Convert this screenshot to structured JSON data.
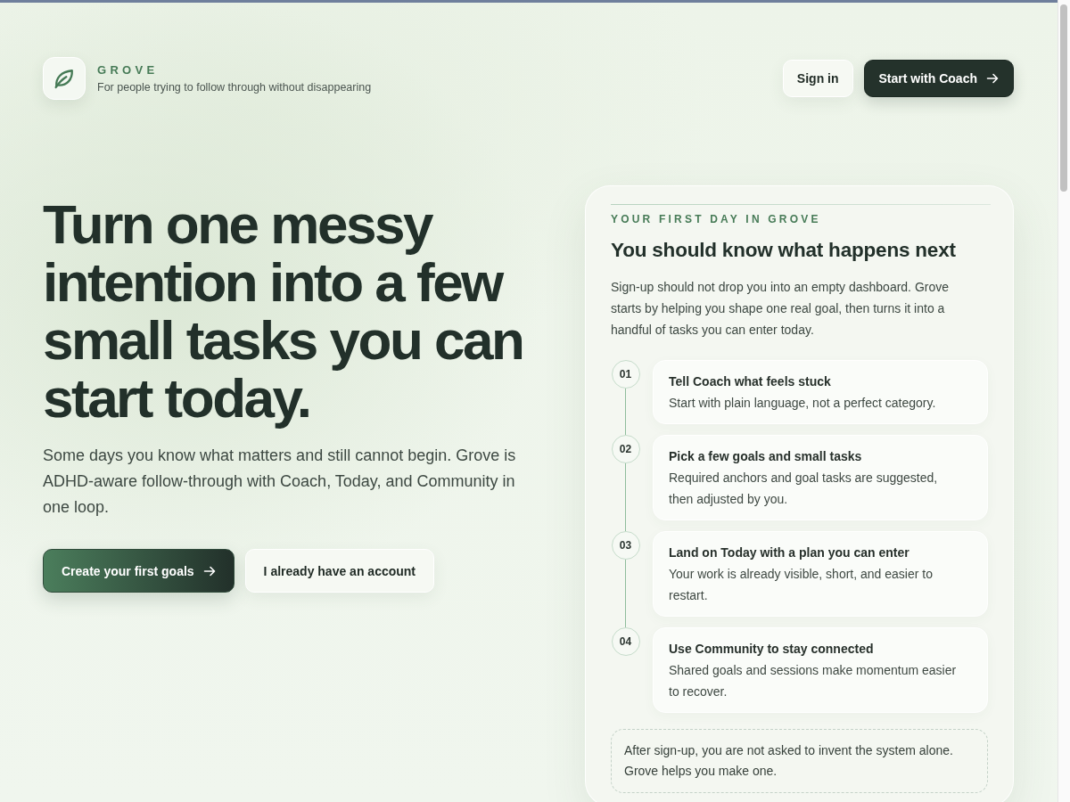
{
  "header": {
    "brand": {
      "name": "GROVE",
      "tagline": "For people trying to follow through without disappearing"
    },
    "actions": [
      {
        "label": "Sign in",
        "kind": "light",
        "arrow": false
      },
      {
        "label": "Start with Coach",
        "kind": "dark",
        "arrow": true
      }
    ]
  },
  "hero": {
    "headline": "Turn one messy intention into a few small tasks you can start today.",
    "description": "Some days you know what matters and still cannot begin. Grove is ADHD-aware follow-through with Coach, Today, and Community in one loop.",
    "actions": [
      {
        "label": "Create your first goals",
        "kind": "gradient",
        "arrow": true
      },
      {
        "label": "I already have an account",
        "kind": "light",
        "arrow": false
      }
    ]
  },
  "first_day_card": {
    "eyebrow": "YOUR FIRST DAY IN GROVE",
    "title": "You should know what happens next",
    "description": "Sign-up should not drop you into an empty dashboard. Grove starts by helping you shape one real goal, then turns it into a handful of tasks you can enter today.",
    "steps": [
      {
        "number": "01",
        "title": "Tell Coach what feels stuck",
        "description": "Start with plain language, not a perfect category."
      },
      {
        "number": "02",
        "title": "Pick a few goals and small tasks",
        "description": "Required anchors and goal tasks are suggested, then adjusted by you."
      },
      {
        "number": "03",
        "title": "Land on Today with a plan you can enter",
        "description": "Your work is already visible, short, and easier to restart."
      },
      {
        "number": "04",
        "title": "Use Community to stay connected",
        "description": "Shared goals and sessions make momentum easier to recover."
      }
    ],
    "note": "After sign-up, you are not asked to invent the system alone. Grove helps you make one."
  }
}
